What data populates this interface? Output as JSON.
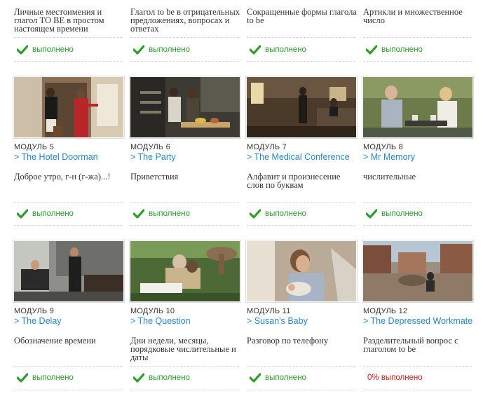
{
  "top_row": [
    {
      "description": "Личные местоимения и глагол TO BE в простом настоящем времени",
      "status": "выполнено"
    },
    {
      "description": "Глагол to be в отрицательных предложениях, вопросах и ответах",
      "status": "выполнено"
    },
    {
      "description": "Сокращенные формы глагола to be",
      "status": "выполнено"
    },
    {
      "description": "Артикли и множественное число",
      "status": "выполнено"
    }
  ],
  "modules": [
    {
      "module": "МОДУЛЬ 5",
      "title": "> The Hotel Doorman",
      "subtitle": "Доброе утро, г-н (г-жа)...!",
      "status": "выполнено",
      "done": true
    },
    {
      "module": "МОДУЛЬ 6",
      "title": "> The Party",
      "subtitle": "Приветствия",
      "status": "выполнено",
      "done": true
    },
    {
      "module": "МОДУЛЬ 7",
      "title": "> The Medical Conference",
      "subtitle": "Алфавит и произнесение слов по буквам",
      "status": "выполнено",
      "done": true
    },
    {
      "module": "МОДУЛЬ 8",
      "title": "> Mr Memory",
      "subtitle": "числительные",
      "status": "выполнено",
      "done": true
    },
    {
      "module": "МОДУЛЬ 9",
      "title": "> The Delay",
      "subtitle": "Обозначение времени",
      "status": "выполнено",
      "done": true
    },
    {
      "module": "МОДУЛЬ 10",
      "title": "> The Question",
      "subtitle": "Дни недели, месяцы, порядковые числительные и даты",
      "status": "выполнено",
      "done": true
    },
    {
      "module": "МОДУЛЬ 11",
      "title": "> Susan's Baby",
      "subtitle": "Разговор по телефону",
      "status": "выполнено",
      "done": true
    },
    {
      "module": "МОДУЛЬ 12",
      "title": "> The Depressed Workmate",
      "subtitle": "Разделительный вопрос с глаголом to be",
      "status": "0% выполнено",
      "done": false
    }
  ],
  "colors": {
    "link": "#2a86c8",
    "done": "#2f9e2f",
    "not_done": "#cc2020"
  }
}
